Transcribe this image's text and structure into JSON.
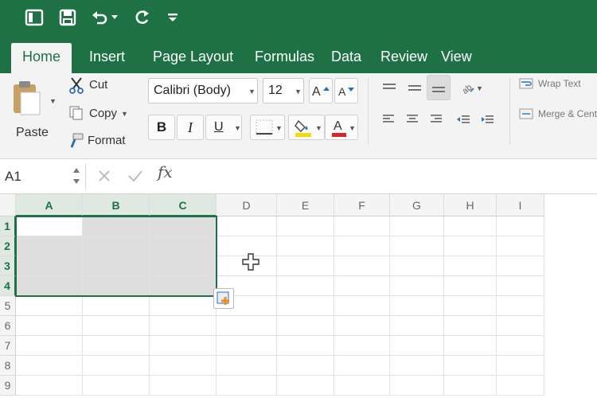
{
  "tabs": [
    {
      "label": "Home",
      "active": true
    },
    {
      "label": "Insert"
    },
    {
      "label": "Page Layout"
    },
    {
      "label": "Formulas"
    },
    {
      "label": "Data"
    },
    {
      "label": "Review"
    },
    {
      "label": "View"
    }
  ],
  "clipboard": {
    "paste": "Paste",
    "cut": "Cut",
    "copy": "Copy",
    "format": "Format"
  },
  "font": {
    "name": "Calibri (Body)",
    "size": "12"
  },
  "alignment": {
    "wrap_text": "Wrap Text",
    "merge_center": "Merge & Center"
  },
  "formula_bar": {
    "cell_ref": "A1",
    "fx": "fx",
    "value": ""
  },
  "sheet": {
    "columns": [
      "A",
      "B",
      "C",
      "D",
      "E",
      "F",
      "G",
      "H",
      "I"
    ],
    "rows": [
      "1",
      "2",
      "3",
      "4",
      "5",
      "6",
      "7",
      "8",
      "9"
    ],
    "selected_range": "A1:C4"
  },
  "colors": {
    "brand": "#1e7145",
    "highlight": "#f5d90a",
    "font_color": "#d9262a"
  }
}
